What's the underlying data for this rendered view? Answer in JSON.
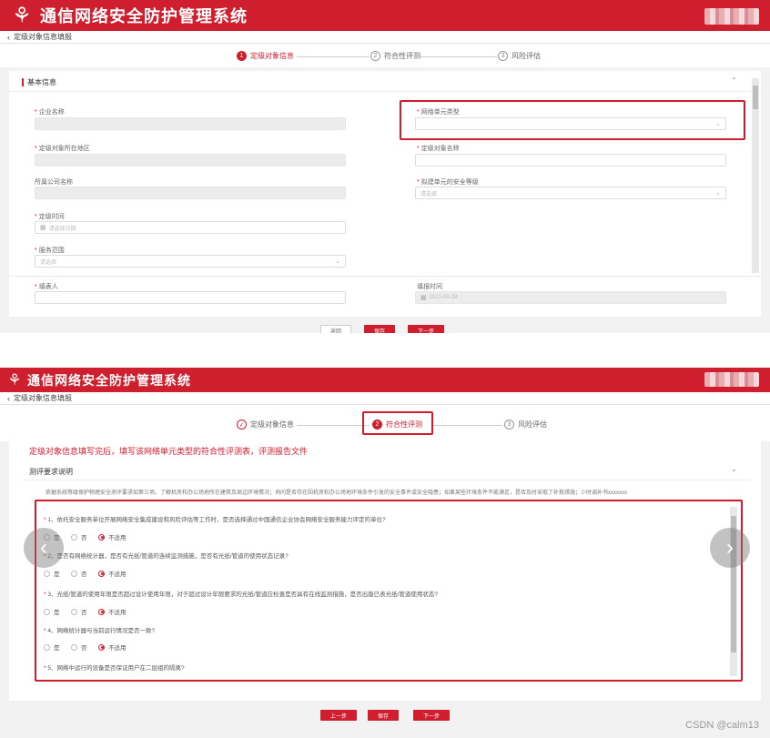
{
  "app": {
    "title": "通信网络安全防护管理系统",
    "logo_icon": "swirl-logo-icon"
  },
  "breadcrumb": {
    "label": "定级对象信息填报"
  },
  "steps": [
    {
      "num": "1",
      "label": "定级对象信息"
    },
    {
      "num": "2",
      "label": "符合性评测"
    },
    {
      "num": "3",
      "label": "风险评估"
    }
  ],
  "step1": {
    "section_title": "基本信息",
    "fields": {
      "company_name": {
        "label": "企业名称",
        "placeholder": ""
      },
      "network_unit_type": {
        "label": "网络单元类型",
        "placeholder": ""
      },
      "region": {
        "label": "定级对象所在地区",
        "placeholder": ""
      },
      "object_name": {
        "label": "定级对象名称",
        "placeholder": ""
      },
      "parent_company": {
        "label": "所属公司名称",
        "placeholder": ""
      },
      "security_level": {
        "label": "拟建单元的安全等级",
        "placeholder": "请选择"
      },
      "grading_time": {
        "label": "定级时间",
        "placeholder": "请选择日期"
      },
      "service_scope": {
        "label": "服务范围",
        "placeholder": "请选择"
      },
      "filler": {
        "label": "填表人",
        "placeholder": ""
      },
      "fill_time": {
        "label": "填报时间",
        "value": "2021-09-28"
      }
    },
    "buttons": {
      "back": "返回",
      "save": "保存",
      "next": "下一步"
    }
  },
  "step2": {
    "annotation": "定级对象信息填写完后，填写该网络单元类型的符合性评测表，评测报告文件",
    "section_title": "测评要求说明",
    "note": "依据系统等级保护物理安全测评要求如第三项。了解机房和办公场地所在建筑及周边环境情况；询问是否存在因机房和办公场地环境条件引发的安全事件或安全隐患；如果某些环境条件不能满足，是否及时采取了补救措施；少时调补书xxxxxxx",
    "questions": [
      {
        "text": "1、依托安全服务单位开展网络安全集成建设和风险评估等工作时，是否选择通过中国通信企业协会网络安全服务能力评定的单位?",
        "selected": "不适用"
      },
      {
        "text": "2、是否有网络统计器，是否有光纸/管道的连续监测措施，是否有光纸/管道的使用状态记录?",
        "selected": "不适用"
      },
      {
        "text": "3、光纸/管道的使用年限是否超过设计使用年限，对于超过设计年限要求的光纸/管道应检查是否具有在线监测措施，是否出版已表光纸/管道使用状态?",
        "selected": "不适用"
      },
      {
        "text": "4、网络统计器与当前运行情况是否一致?",
        "selected": "不适用"
      },
      {
        "text": "5、网络中运行的设备是否保证用户在二层组的隔离?",
        "selected": ""
      }
    ],
    "options": [
      "是",
      "否",
      "不适用"
    ],
    "buttons": {
      "prev": "上一步",
      "save": "保存",
      "next": "下一步"
    }
  },
  "watermark": "CSDN @calm13",
  "colors": {
    "brand": "#cf1f2e",
    "annotation": "#d11a2a"
  }
}
